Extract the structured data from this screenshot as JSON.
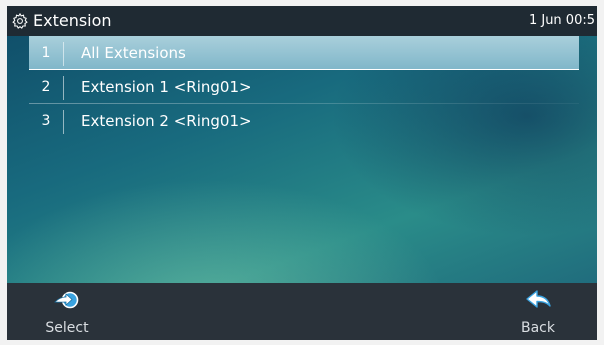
{
  "header": {
    "title": "Extension",
    "date": "1 Jun 00:5",
    "icon": "gear-icon"
  },
  "list": {
    "items": [
      {
        "number": "1",
        "label": "All Extensions",
        "selected": true
      },
      {
        "number": "2",
        "label": "Extension  1 <Ring01>",
        "selected": false
      },
      {
        "number": "3",
        "label": "Extension  2 <Ring01>",
        "selected": false
      }
    ]
  },
  "softkeys": {
    "select": {
      "label": "Select",
      "icon": "select-arrow-icon"
    },
    "back": {
      "label": "Back",
      "icon": "back-arrow-icon"
    }
  },
  "colors": {
    "titlebar": "#1f2a33",
    "softkey_bar": "#2a323a",
    "selection": "#a9cfdb",
    "accent_icon": "#3aa3e0"
  }
}
